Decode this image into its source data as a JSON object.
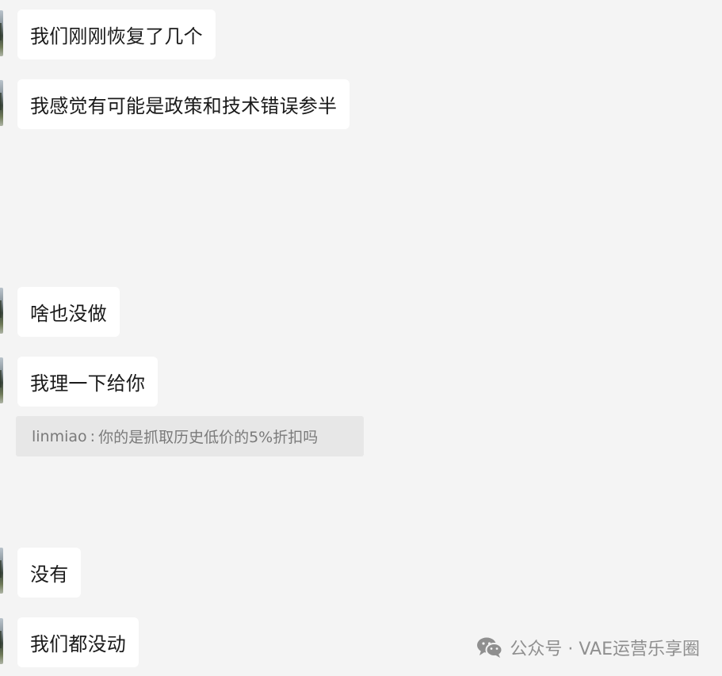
{
  "messages": [
    {
      "text": "我们刚刚恢复了几个"
    },
    {
      "text": "我感觉有可能是政策和技术错误参半"
    },
    {
      "text": "啥也没做"
    },
    {
      "text": "我理一下给你"
    },
    {
      "text": "没有"
    },
    {
      "text": "我们都没动"
    }
  ],
  "quote": {
    "author": "linmiao",
    "separator": ":",
    "text": "你的是抓取历史低价的5%折扣吗"
  },
  "watermark": {
    "icon": "wechat-icon",
    "text": "公众号 · VAE运营乐享圈"
  },
  "colors": {
    "background": "#f4f4f4",
    "bubble": "#ffffff",
    "quote_background": "#e7e7e7",
    "quote_text": "#7a7a7a",
    "watermark_text": "#8f8f8f"
  }
}
